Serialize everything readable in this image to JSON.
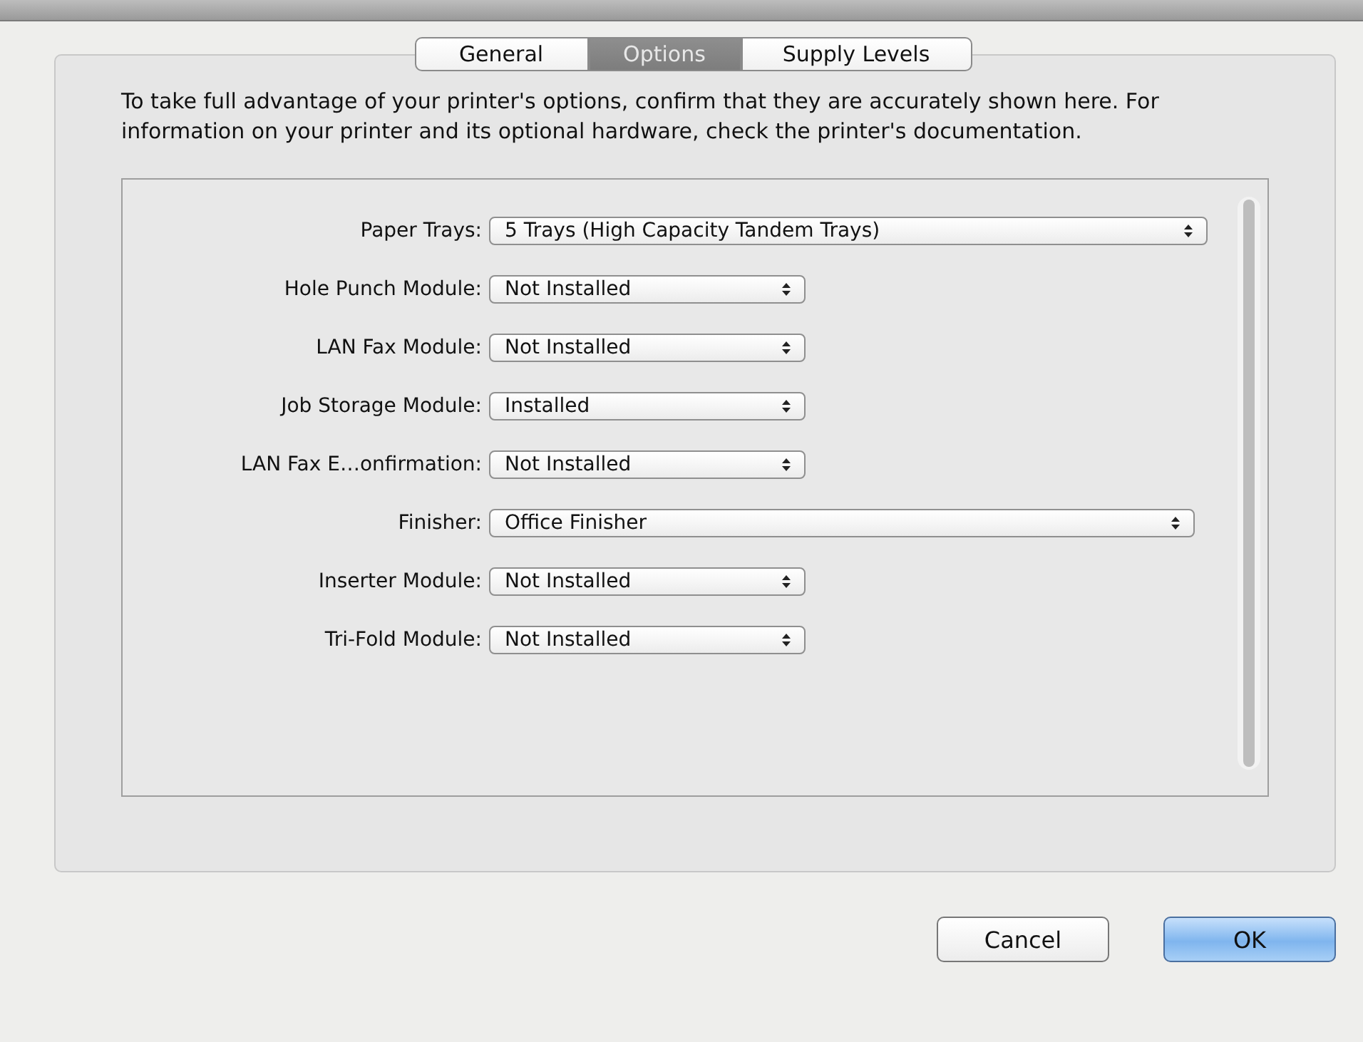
{
  "tabs": [
    {
      "label": "General",
      "selected": false
    },
    {
      "label": "Options",
      "selected": true
    },
    {
      "label": "Supply Levels",
      "selected": false
    }
  ],
  "description": "To take full advantage of your printer's options, confirm that they are accurately shown here. For information on your printer and its optional hardware, check the printer's documentation.",
  "options": [
    {
      "label": "Paper Trays:",
      "value": "5 Trays (High Capacity Tandem Trays)"
    },
    {
      "label": "Hole Punch Module:",
      "value": "Not Installed"
    },
    {
      "label": "LAN Fax Module:",
      "value": "Not Installed"
    },
    {
      "label": "Job Storage Module:",
      "value": "Installed"
    },
    {
      "label": "LAN Fax E…onfirmation:",
      "value": "Not Installed"
    },
    {
      "label": "Finisher:",
      "value": "Office Finisher"
    },
    {
      "label": "Inserter Module:",
      "value": "Not Installed"
    },
    {
      "label": "Tri-Fold Module:",
      "value": "Not Installed"
    }
  ],
  "buttons": [
    {
      "label": "Cancel",
      "default": false
    },
    {
      "label": "OK",
      "default": true
    }
  ]
}
